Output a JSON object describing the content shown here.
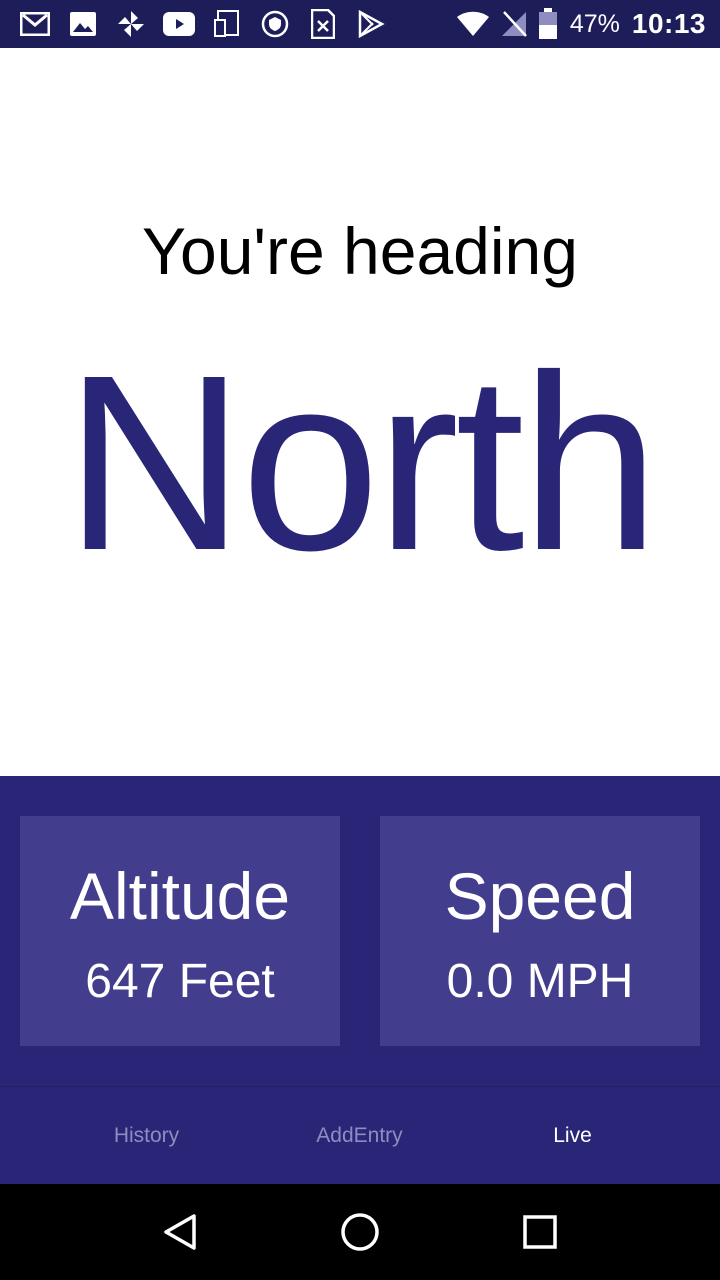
{
  "status_bar": {
    "notification_icons": [
      "gmail-icon",
      "photos-icon",
      "pinwheel-icon",
      "youtube-icon",
      "device-icon",
      "shield-icon",
      "sim-icon",
      "play-store-icon"
    ],
    "battery_percent": "47%",
    "time": "10:13"
  },
  "heading": {
    "prefix": "You're heading",
    "direction": "North"
  },
  "stats": {
    "altitude": {
      "title": "Altitude",
      "value": "647 Feet"
    },
    "speed": {
      "title": "Speed",
      "value": "0.0 MPH"
    }
  },
  "tabs": [
    {
      "label": "History",
      "active": false
    },
    {
      "label": "AddEntry",
      "active": false
    },
    {
      "label": "Live",
      "active": true
    }
  ],
  "colors": {
    "primary": "#2a2677",
    "card": "#433d8d",
    "tab_inactive": "#8f8cbf",
    "tab_active": "#ffffff"
  },
  "nav": {
    "back_icon": "back-triangle-icon",
    "home_icon": "home-circle-icon",
    "recents_icon": "recents-square-icon"
  }
}
